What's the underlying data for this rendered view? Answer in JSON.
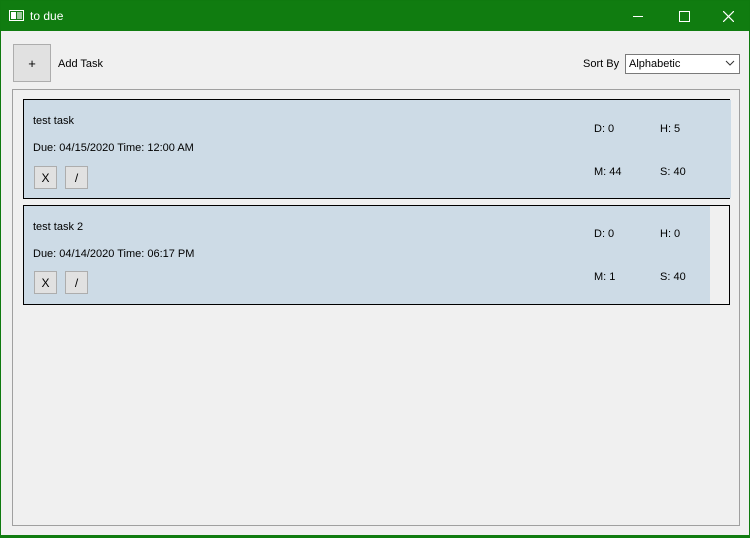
{
  "window": {
    "title": "to due",
    "accent": "#107c10"
  },
  "titlebar": {
    "icons": [
      "minimize-icon",
      "maximize-icon",
      "close-icon"
    ]
  },
  "toolbar": {
    "add_button_label": "+",
    "add_label": "Add Task",
    "sort_label": "Sort By",
    "sort_value": "Alphabetic"
  },
  "tasks": [
    {
      "name": "test task",
      "due": "Due: 04/15/2020 Time: 12:00 AM",
      "days": "D: 0",
      "hours": "H: 5",
      "minutes": "M: 44",
      "seconds": "S: 40",
      "delete_label": "X",
      "edit_label": "/"
    },
    {
      "name": "test task 2",
      "due": "Due: 04/14/2020 Time: 06:17 PM",
      "days": "D: 0",
      "hours": "H: 0",
      "minutes": "M: 1",
      "seconds": "S: 40",
      "delete_label": "X",
      "edit_label": "/"
    }
  ],
  "colors": {
    "card_fill": "#cddbe6",
    "window_bg": "#f0f0f0"
  }
}
